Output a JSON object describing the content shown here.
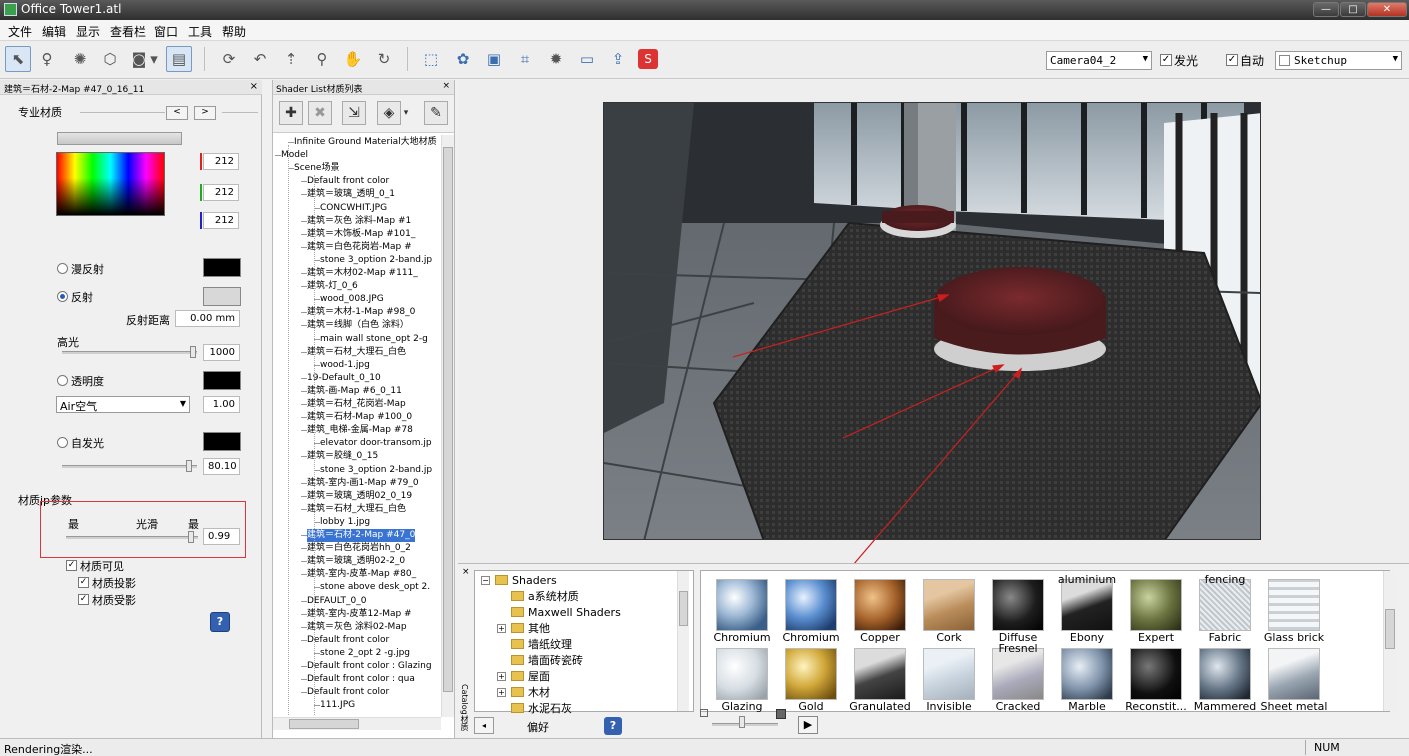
{
  "window": {
    "title": "Office Tower1.atl",
    "min": "—",
    "max": "□",
    "close": "✕"
  },
  "menu": [
    "文件",
    "编辑",
    "显示",
    "查看栏",
    "窗口",
    "工具",
    "帮助"
  ],
  "toolbar": {
    "camera": "Camera04_2",
    "glow_label": "发光",
    "auto_label": "自动",
    "preset": "Sketchup"
  },
  "material_panel": {
    "title": "建筑＝石材-2-Map #47_0_16_11",
    "close": "×",
    "section": "专业材质",
    "nav_prev": "<",
    "nav_next": ">",
    "rgb": [
      "212",
      "212",
      "212"
    ],
    "diffuse_label": "漫反射",
    "reflect_label": "反射",
    "reflect_distance_label": "反射距离",
    "reflect_distance": "0.00 mm",
    "highlight_label": "高光",
    "highlight_value": "1000",
    "transparency_label": "透明度",
    "medium_select": "Air空气",
    "medium_value": "1.00",
    "emit_label": "自发光",
    "emit_value": "80.10",
    "jp_label": "材质jp参数",
    "min_label": "最",
    "smooth_label": "光滑",
    "max_label": "最",
    "smooth_value": "0.99",
    "visible_label": "材质可见",
    "cast_label": "材质投影",
    "receive_label": "材质受影",
    "help": "?",
    "colors": {
      "diffuse": "#000000",
      "reflect": "#d8d8d8",
      "transparency": "#000000",
      "emit": "#000000",
      "highlight_box": "#d9363e"
    }
  },
  "shader_list": {
    "title": "Shader List材质列表",
    "close": "×",
    "rows": [
      {
        "text": "Infinite Ground Material大地材质",
        "indent": 1
      },
      {
        "text": "Model",
        "indent": 0
      },
      {
        "text": "Scene场景",
        "indent": 1
      },
      {
        "text": "Default front color",
        "indent": 2
      },
      {
        "text": "建筑＝玻璃_透明_0_1",
        "indent": 2
      },
      {
        "text": "CONCWHIT.JPG",
        "indent": 3
      },
      {
        "text": "建筑＝灰色 涂料-Map #1",
        "indent": 2
      },
      {
        "text": "建筑＝木饰板-Map #101_",
        "indent": 2
      },
      {
        "text": "建筑＝白色花岗岩-Map #",
        "indent": 2
      },
      {
        "text": "stone 3_option 2-band.jp",
        "indent": 3
      },
      {
        "text": "建筑＝木材02-Map #111_",
        "indent": 2
      },
      {
        "text": "建筑-灯_0_6",
        "indent": 2
      },
      {
        "text": "wood_008.JPG",
        "indent": 3
      },
      {
        "text": "建筑＝木材-1-Map #98_0",
        "indent": 2
      },
      {
        "text": "建筑＝线脚（白色 涂料）",
        "indent": 2
      },
      {
        "text": "main wall stone_opt 2-g",
        "indent": 3
      },
      {
        "text": "建筑＝石材_大理石_白色",
        "indent": 2
      },
      {
        "text": "wood-1.jpg",
        "indent": 3
      },
      {
        "text": "19-Default_0_10",
        "indent": 2
      },
      {
        "text": "建筑-画-Map #6_0_11",
        "indent": 2
      },
      {
        "text": "建筑＝石材_花岗岩-Map",
        "indent": 2
      },
      {
        "text": "建筑＝石材-Map #100_0",
        "indent": 2
      },
      {
        "text": "建筑_电梯-金属-Map #78",
        "indent": 2
      },
      {
        "text": "elevator door-transom.jp",
        "indent": 3
      },
      {
        "text": "建筑＝胶缝_0_15",
        "indent": 2
      },
      {
        "text": "stone 3_option 2-band.jp",
        "indent": 3
      },
      {
        "text": "建筑-室内-画1-Map #79_0",
        "indent": 2
      },
      {
        "text": "建筑＝玻璃_透明02_0_19",
        "indent": 2
      },
      {
        "text": "建筑＝石材_大理石_白色",
        "indent": 2
      },
      {
        "text": "lobby 1.jpg",
        "indent": 3
      },
      {
        "text": "建筑＝石材-2-Map #47_0",
        "indent": 2,
        "selected": true
      },
      {
        "text": "建筑＝白色花岗岩hh_0_2",
        "indent": 2
      },
      {
        "text": "建筑＝玻璃_透明02-2_0",
        "indent": 2
      },
      {
        "text": "建筑-室内-皮革-Map #80_",
        "indent": 2
      },
      {
        "text": "stone above desk_opt 2.",
        "indent": 3
      },
      {
        "text": "DEFAULT_0_0",
        "indent": 2
      },
      {
        "text": "建筑-室内-皮革12-Map #",
        "indent": 2
      },
      {
        "text": "建筑＝灰色 涂料02-Map",
        "indent": 2
      },
      {
        "text": "Default front color",
        "indent": 2
      },
      {
        "text": "stone 2_opt 2 -g.jpg",
        "indent": 3
      },
      {
        "text": "Default front color : Glazing",
        "indent": 2
      },
      {
        "text": "Default front color : qua",
        "indent": 2
      },
      {
        "text": "Default front color",
        "indent": 2
      },
      {
        "text": "111.JPG",
        "indent": 3
      }
    ]
  },
  "browser": {
    "side_label": "Catalog材质",
    "folders": [
      {
        "text": "Shaders",
        "indent": 0,
        "exp": "−"
      },
      {
        "text": "a系统材质",
        "indent": 1
      },
      {
        "text": "Maxwell Shaders",
        "indent": 1
      },
      {
        "text": "其他",
        "indent": 1,
        "exp": "+"
      },
      {
        "text": "墙纸纹理",
        "indent": 1
      },
      {
        "text": "墙面砖瓷砖",
        "indent": 1
      },
      {
        "text": "屋面",
        "indent": 1,
        "exp": "+"
      },
      {
        "text": "木材",
        "indent": 1,
        "exp": "+"
      },
      {
        "text": "水泥石灰",
        "indent": 1
      }
    ],
    "fav_label": "偏好",
    "help": "?",
    "play": "▶",
    "thumbs": [
      {
        "cap": "Chromium",
        "style": "chrome"
      },
      {
        "cap": "Chromium",
        "style": "chrome2"
      },
      {
        "cap": "Copper",
        "style": "copper"
      },
      {
        "cap": "Cork",
        "style": "cork"
      },
      {
        "cap": "Diffuse",
        "style": "dark"
      },
      {
        "cap": "Ebony",
        "top": "aluminium",
        "style": "ebony"
      },
      {
        "cap": "Expert",
        "style": "expert"
      },
      {
        "cap": "Fabric",
        "top": "fencing",
        "style": "fabric"
      },
      {
        "cap": "Glass brick",
        "style": "glassbrick"
      },
      {
        "cap": "Glazing",
        "style": "glazing"
      },
      {
        "cap": "Gold",
        "style": "gold"
      },
      {
        "cap": "Granulated",
        "style": "granulated"
      },
      {
        "cap": "Invisible",
        "style": "invisible"
      },
      {
        "cap": "Cracked",
        "top": "Fresnel",
        "style": "cracked"
      },
      {
        "cap": "Marble",
        "style": "marble"
      },
      {
        "cap": "Reconstit...",
        "style": "recon"
      },
      {
        "cap": "Mammered",
        "style": "mammered"
      },
      {
        "cap": "Sheet metal",
        "style": "sheet"
      }
    ]
  },
  "status": {
    "text": "Rendering渲染...",
    "num": "NUM"
  }
}
